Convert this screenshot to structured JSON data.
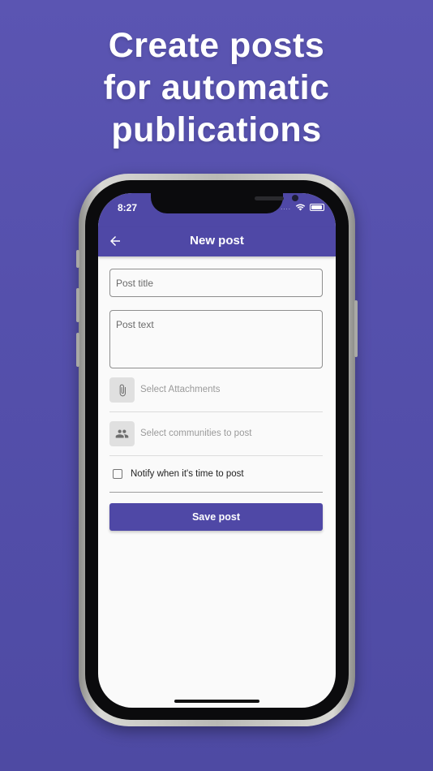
{
  "headline": {
    "line1": "Create posts",
    "line2": "for automatic",
    "line3": "publications"
  },
  "status_bar": {
    "time": "8:27",
    "signal": "....",
    "icons": [
      "wifi-icon",
      "battery-icon"
    ]
  },
  "app_bar": {
    "back_icon": "arrow-left-icon",
    "title": "New post"
  },
  "form": {
    "post_title_placeholder": "Post title",
    "post_text_placeholder": "Post text",
    "attachments_label": "Select Attachments",
    "attachments_icon": "paperclip-icon",
    "communities_label": "Select communities to post",
    "communities_icon": "people-icon",
    "notify_label": "Notify when it's time to post",
    "notify_checked": false,
    "save_label": "Save post"
  },
  "colors": {
    "accent": "#4f48a6",
    "background_top": "#5b55b2",
    "background_bottom": "#4e4aa3"
  }
}
